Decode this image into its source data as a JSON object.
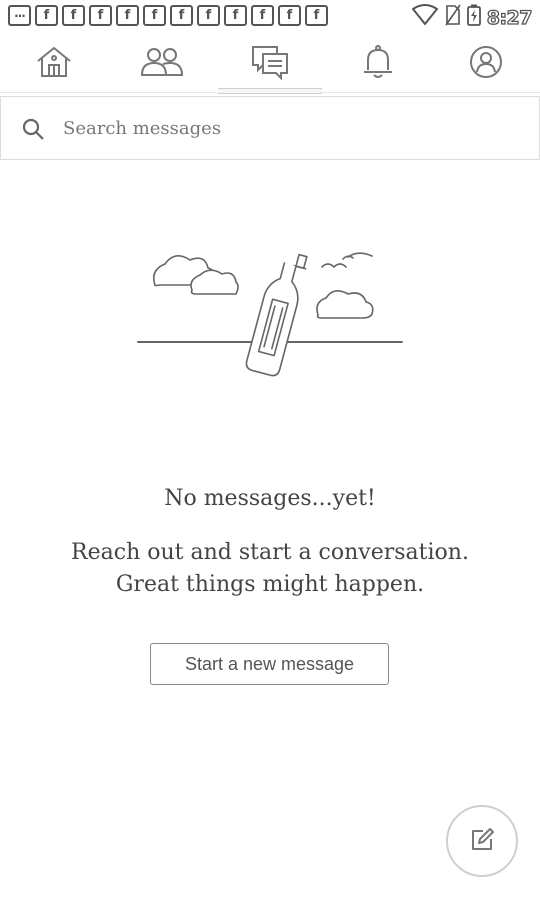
{
  "status_bar": {
    "time": "8:27",
    "notifications": [
      "···",
      "f",
      "f",
      "f",
      "f",
      "f",
      "f",
      "f",
      "f",
      "f",
      "f",
      "f"
    ]
  },
  "nav": {
    "items": [
      {
        "name": "home-icon"
      },
      {
        "name": "people-icon"
      },
      {
        "name": "messages-icon",
        "active": true
      },
      {
        "name": "bell-icon"
      },
      {
        "name": "profile-icon"
      }
    ]
  },
  "search": {
    "placeholder": "Search messages",
    "value": ""
  },
  "empty_state": {
    "title": "No messages...yet!",
    "line1": "Reach out and start a conversation.",
    "line2": "Great things might happen.",
    "button_label": "Start a new message"
  },
  "fab": {
    "icon": "compose-icon"
  },
  "colors": {
    "icon": "#777777",
    "text": "#444444",
    "border": "#dcdcdc"
  }
}
